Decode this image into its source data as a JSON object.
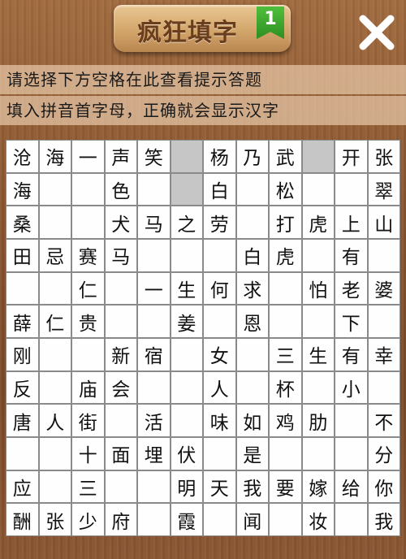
{
  "header": {
    "title": "疯狂填字",
    "level": "1",
    "close_icon": "close-x-icon"
  },
  "hints": {
    "line1": "请选择下方空格在此查看提示答题",
    "line2": "填入拼音首字母，正确就会显示汉字"
  },
  "grid": [
    [
      "沧",
      "海",
      "一",
      "声",
      "笑",
      "#",
      "杨",
      "乃",
      "武",
      "#",
      "开",
      "张"
    ],
    [
      "海",
      "",
      "",
      "色",
      "",
      "#",
      "白",
      "",
      "松",
      "",
      "",
      "翠"
    ],
    [
      "桑",
      "",
      "",
      "犬",
      "马",
      "之",
      "劳",
      "",
      "打",
      "虎",
      "上",
      "山"
    ],
    [
      "田",
      "忌",
      "赛",
      "马",
      "",
      "",
      "",
      "白",
      "虎",
      "",
      "有",
      ""
    ],
    [
      "",
      "",
      "仁",
      "",
      "一",
      "生",
      "何",
      "求",
      "",
      "怕",
      "老",
      "婆"
    ],
    [
      "薛",
      "仁",
      "贵",
      "",
      "",
      "姜",
      "",
      "恩",
      "",
      "",
      "下",
      ""
    ],
    [
      "刚",
      "",
      "",
      "新",
      "宿",
      "",
      "女",
      "",
      "三",
      "生",
      "有",
      "幸"
    ],
    [
      "反",
      "",
      "庙",
      "会",
      "",
      "",
      "人",
      "",
      "杯",
      "",
      "小",
      ""
    ],
    [
      "唐",
      "人",
      "街",
      "",
      "活",
      "",
      "味",
      "如",
      "鸡",
      "肋",
      "",
      "不"
    ],
    [
      "",
      "",
      "十",
      "面",
      "埋",
      "伏",
      "",
      "是",
      "",
      "",
      "",
      "分"
    ],
    [
      "应",
      "",
      "三",
      "",
      "",
      "明",
      "天",
      "我",
      "要",
      "嫁",
      "给",
      "你"
    ],
    [
      "酬",
      "张",
      "少",
      "府",
      "",
      "霞",
      "",
      "闻",
      "",
      "妆",
      "",
      "我"
    ]
  ]
}
